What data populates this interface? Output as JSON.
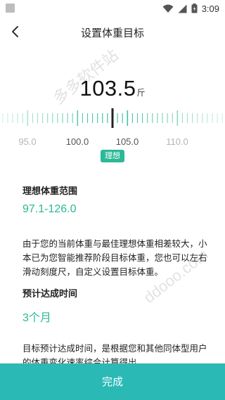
{
  "status_bar": {
    "time": "3:09",
    "icons": [
      "wifi-icon",
      "signal-icon",
      "battery-icon"
    ]
  },
  "header": {
    "title": "设置体重目标",
    "back_icon": "chevron-left-icon"
  },
  "weight": {
    "value": "103.5",
    "unit": "斤"
  },
  "ruler": {
    "labels": [
      "95.0",
      "100.0",
      "105.0",
      "110.0"
    ],
    "ideal_badge": "理想",
    "accent_color": "#2bb996"
  },
  "ideal_range": {
    "label": "理想体重范围",
    "value": "97.1-126.0"
  },
  "advice": {
    "text": "由于您的当前体重与最佳理想体重相差较大，小本已为您智能推荐阶段目标体重，您也可以左右滑动刻度尺，自定义设置目标体重。"
  },
  "eta": {
    "label": "预计达成时间",
    "value": "3个月"
  },
  "eta_note": {
    "text": "目标预计达成时间，是根据您和其他同体型用户的体重变化速率综合计算得出。"
  },
  "footer": {
    "done_label": "完成",
    "button_color": "#2bb9b6"
  },
  "watermarks": [
    "ddooo.com",
    "多多软件站"
  ]
}
